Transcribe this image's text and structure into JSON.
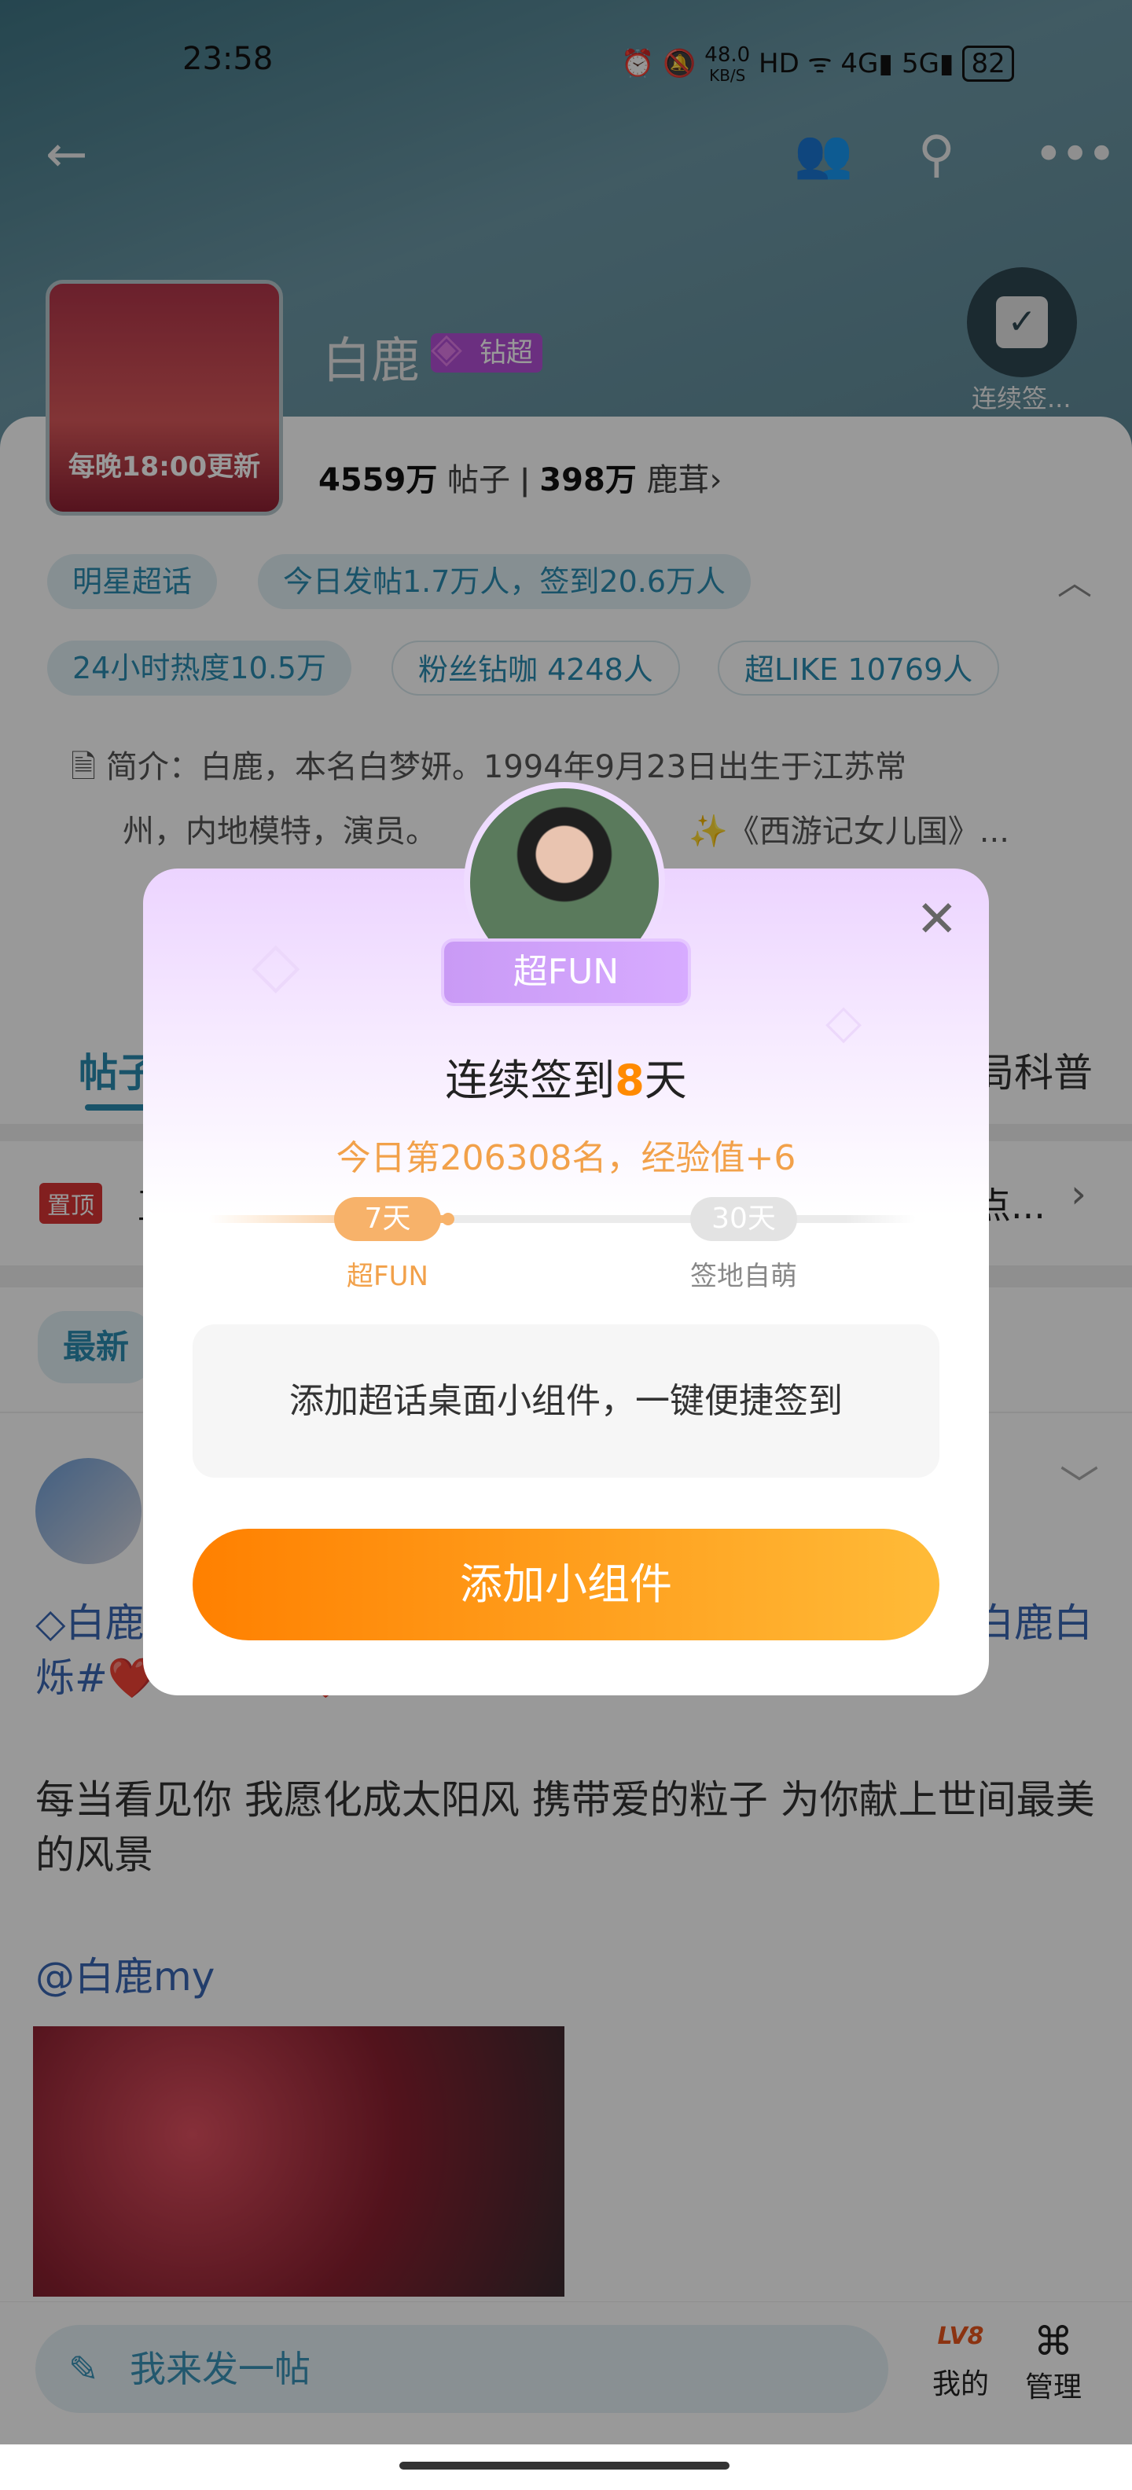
{
  "status_bar": {
    "time": "23:58",
    "net_speed": "48.0",
    "net_unit": "KB/S",
    "hd": "HD",
    "signal_1": "4G",
    "signal_2": "5G",
    "battery": "82"
  },
  "nav": {
    "back_icon": "arrow-left-icon",
    "icons": [
      "group-chat-icon",
      "search-icon",
      "more-icon"
    ]
  },
  "topic": {
    "cover_text": "每晚18:00更新",
    "name": "白鹿",
    "badge": "钻超",
    "posts_count": "4559万",
    "posts_label": "帖子",
    "fans_count": "398万",
    "fans_label": "鹿茸",
    "sign_label": "连续签..."
  },
  "tags": [
    "明星超话",
    "今日发帖1.7万人，签到20.6万人",
    "24小时热度10.5万",
    "粉丝钻咖 4248人",
    "超LIKE 10769人"
  ],
  "intro": {
    "line1": "简介：白鹿，本名白梦妍。1994年9月23日出生于江苏常",
    "line2": "州，内地模特，演员。",
    "line2_tail": "✨《西游记女儿国》..."
  },
  "tabs": {
    "active": "帖子",
    "right": "局科普"
  },
  "pinned": {
    "badge": "置顶",
    "text_start": "直",
    "text_end": "点..."
  },
  "filter": {
    "active": "最新"
  },
  "post": {
    "line1_start": "白鹿",
    "line1_end": "白鹿白",
    "line2": "烁#❤️#白鹿#❤️#白鹿白月梵星#",
    "content": "每当看见你 我愿化成太阳风 携带爱的粒子 为你献上世间最美的风景",
    "mention": "@白鹿my"
  },
  "bottom": {
    "input_placeholder": "我来发一帖",
    "mine_label": "我的",
    "level": "LV8",
    "manage_label": "管理"
  },
  "modal": {
    "badge": "超FUN",
    "title_prefix": "连续签到",
    "days": "8",
    "title_suffix": "天",
    "subtitle": "今日第206308名，经验值+6",
    "milestones": [
      {
        "pill": "7天",
        "label": "超FUN"
      },
      {
        "pill": "30天",
        "label": "签地自萌"
      }
    ],
    "progress_days": 8,
    "tip": "添加超话桌面小组件，一键便捷签到",
    "button": "添加小组件"
  },
  "colors": {
    "accent": "#ff8a00",
    "tag_text": "#2a8bb0",
    "link": "#3a66b3",
    "modal_top": "#ecd4ff"
  }
}
